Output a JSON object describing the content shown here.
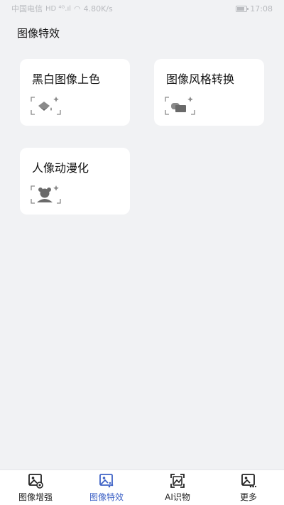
{
  "status_bar": {
    "carrier": "中国电信",
    "network_speed": "4.80K/s",
    "time": "17:08"
  },
  "page": {
    "title": "图像特效"
  },
  "cards": [
    {
      "label": "黑白图像上色",
      "icon": "colorize-icon"
    },
    {
      "label": "图像风格转换",
      "icon": "style-transfer-icon"
    },
    {
      "label": "人像动漫化",
      "icon": "anime-portrait-icon"
    }
  ],
  "tabbar": {
    "tabs": [
      {
        "label": "图像增强",
        "icon": "image-enhance-icon",
        "active": false
      },
      {
        "label": "图像特效",
        "icon": "image-effects-icon",
        "active": true
      },
      {
        "label": "AI识物",
        "icon": "ai-recognize-icon",
        "active": false
      },
      {
        "label": "更多",
        "icon": "more-icon",
        "active": false
      }
    ]
  },
  "colors": {
    "background": "#f1f2f4",
    "card": "#ffffff",
    "active_tab": "#3f63c6",
    "icon_gray": "#888888"
  }
}
